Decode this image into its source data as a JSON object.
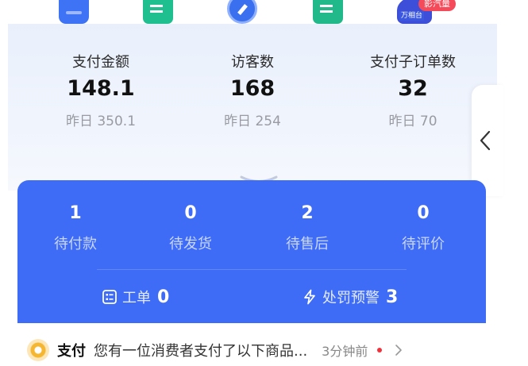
{
  "top_icons": [
    {
      "icon": "shopping-bag-icon",
      "color": "#3f73f5"
    },
    {
      "icon": "document-icon",
      "color": "#1fbf8f"
    },
    {
      "icon": "compass-icon",
      "color": "#3a6ff0"
    },
    {
      "icon": "edit-document-icon",
      "color": "#22b98a"
    },
    {
      "icon": "workbench-icon",
      "color": "#3d4fd8",
      "badge": "影汽量",
      "label": "万相台"
    }
  ],
  "stats": [
    {
      "label": "支付金额",
      "value": "148.1",
      "yesterday": "昨日 350.1"
    },
    {
      "label": "访客数",
      "value": "168",
      "yesterday": "昨日 254"
    },
    {
      "label": "支付子订单数",
      "value": "32",
      "yesterday": "昨日 70"
    }
  ],
  "orders": [
    {
      "count": "1",
      "label": "待付款"
    },
    {
      "count": "0",
      "label": "待发货"
    },
    {
      "count": "2",
      "label": "待售后"
    },
    {
      "count": "0",
      "label": "待评价"
    }
  ],
  "work_items": {
    "ticket": {
      "label": "工单",
      "count": "0"
    },
    "penalty": {
      "label": "处罚预警",
      "count": "3"
    }
  },
  "notice": {
    "type": "支付",
    "text": "您有一位消费者支付了以下商品...",
    "time": "3分钟前"
  },
  "colors": {
    "accent": "#3e6cf6",
    "badge_red": "#f44a5a",
    "notice_icon": "#f5b631"
  }
}
